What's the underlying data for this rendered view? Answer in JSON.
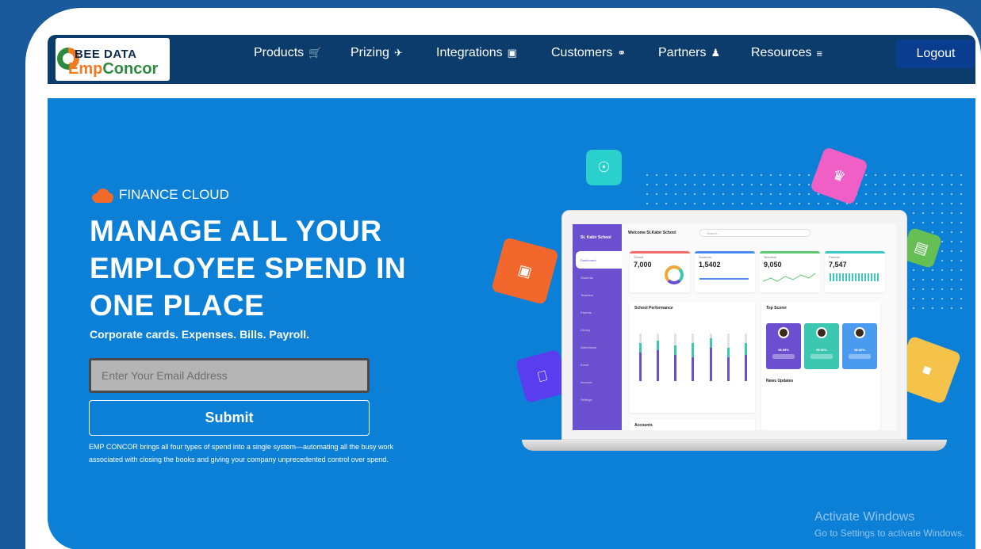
{
  "logo": {
    "line1": "BEE DATA",
    "line2a": "Emp",
    "line2b": "Concor"
  },
  "nav": {
    "items": [
      {
        "label": "Products",
        "icon": "cart-icon"
      },
      {
        "label": "Prizing",
        "icon": "rocket-icon"
      },
      {
        "label": "Integrations",
        "icon": "plug-icon"
      },
      {
        "label": "Customers",
        "icon": "headset-icon"
      },
      {
        "label": "Partners",
        "icon": "users-icon"
      },
      {
        "label": "Resources",
        "icon": "list-icon"
      }
    ],
    "logout_label": "Logout"
  },
  "hero": {
    "badge": "FINANCE CLOUD",
    "headline": "MANAGE ALL YOUR EMPLOYEE SPEND IN ONE PLACE",
    "tagline": "Corporate cards. Expenses. Bills. Payroll.",
    "email_placeholder": "Enter Your Email Address",
    "submit_label": "Submit",
    "description": "EMP CONCOR brings all four types of spend into a single system—automating all the busy work associated with closing the books and giving your company unprecedented control over spend."
  },
  "dashboard": {
    "school": "St. Kabir School",
    "welcome": "Welcome St.Kabir School",
    "search_placeholder": "Search...",
    "sidebar": [
      "Dashboard",
      "Students",
      "Teachers",
      "Parents",
      "Library",
      "Attendance",
      "Event",
      "Account",
      "Settings"
    ],
    "stats": [
      {
        "label": "School",
        "value": "7,000",
        "color": "#f26b6b"
      },
      {
        "label": "Students",
        "value": "1,5402",
        "color": "#4a8df0"
      },
      {
        "label": "Teachers",
        "value": "9,050",
        "color": "#5cc870"
      },
      {
        "label": "Parents",
        "value": "7,547",
        "color": "#3bc7c4"
      }
    ],
    "performance_title": "School Performance",
    "top_scorer_title": "Top Scorer",
    "news_title": "News Updates",
    "accounts_title": "Accounts",
    "scorers": [
      {
        "pct": "98.99%",
        "color": "#6a4fcf"
      },
      {
        "pct": "95.00%",
        "color": "#3bc7b0"
      },
      {
        "pct": "98.00%",
        "color": "#4a9af0"
      }
    ]
  },
  "watermark": {
    "title": "Activate Windows",
    "subtitle": "Go to Settings to activate Windows."
  }
}
